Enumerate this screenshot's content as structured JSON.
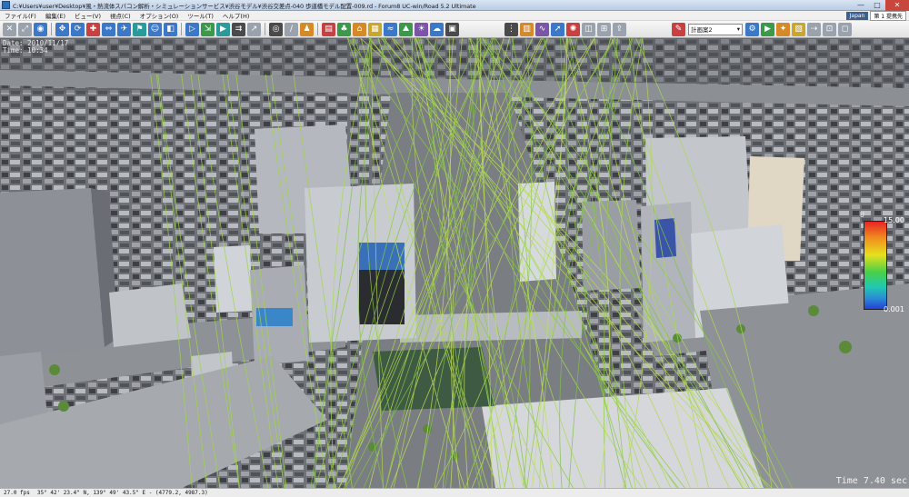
{
  "window": {
    "title": "C:¥Users¥user¥Desktop¥風・熱流体スパコン解析・シミュレーションサービス¥渋谷モデル¥渋谷交差点-040 歩道橋モデル配置-009.rd - Forum8 UC-win/Road 5.2 Ultimate",
    "minimize": "—",
    "maximize": "□",
    "close": "✕"
  },
  "menu": {
    "items": [
      "ファイル(F)",
      "編集(E)",
      "ビュー(V)",
      "視点(C)",
      "オプション(O)",
      "ツール(T)",
      "ヘルプ(H)"
    ],
    "language": "Japan",
    "project": "第 1 提携先"
  },
  "toolbar": {
    "plan_select": "計画案2",
    "plan_select_arrow": "▾"
  },
  "viewport": {
    "date": "Date: 2010/11/17",
    "time": "Time: 10:34",
    "sim_time": "Time   7.40 sec"
  },
  "legend": {
    "label": "U",
    "max": "15.00",
    "min": "0.001",
    "colors": [
      "#e82424",
      "#f08a1e",
      "#e8e01e",
      "#48d048",
      "#20c8b4",
      "#2a8ad4",
      "#2440d8"
    ]
  },
  "status": {
    "fps": "27.0 fps",
    "coords": "35°  42' 23.4\" N, 139°  49' 43.5\" E  -  (4779.2, 4987.3)"
  },
  "colors": {
    "streamline": "#9fd64a",
    "building_light": "#c9ccd2",
    "building_dark": "#7d8088",
    "ground": "#6b6d70"
  }
}
